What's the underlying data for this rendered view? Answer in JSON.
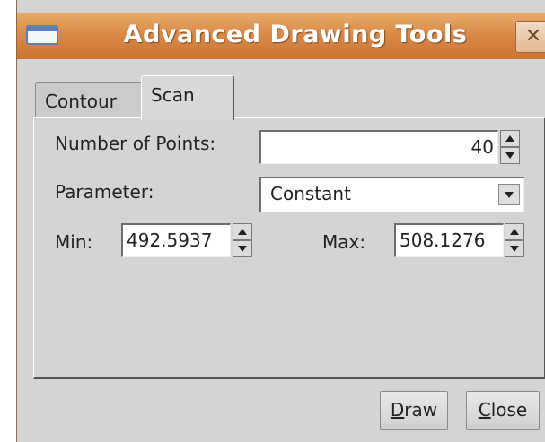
{
  "window": {
    "title": "Advanced Drawing Tools",
    "close_glyph": "✕"
  },
  "tabs": [
    {
      "label": "Contour",
      "active": false
    },
    {
      "label": "Scan",
      "active": true
    }
  ],
  "scan": {
    "points": {
      "label": "Number of Points:",
      "value": "40"
    },
    "parameter": {
      "label": "Parameter:",
      "value": "Constant"
    },
    "min": {
      "label": "Min:",
      "value": "492.5937"
    },
    "max": {
      "label": "Max:",
      "value": "508.1276"
    }
  },
  "buttons": {
    "draw": {
      "mnemonic": "D",
      "rest": "raw"
    },
    "close": {
      "mnemonic": "C",
      "rest": "lose"
    }
  },
  "colors": {
    "titlebar": "#d98a48",
    "background": "#d4d4d4"
  }
}
